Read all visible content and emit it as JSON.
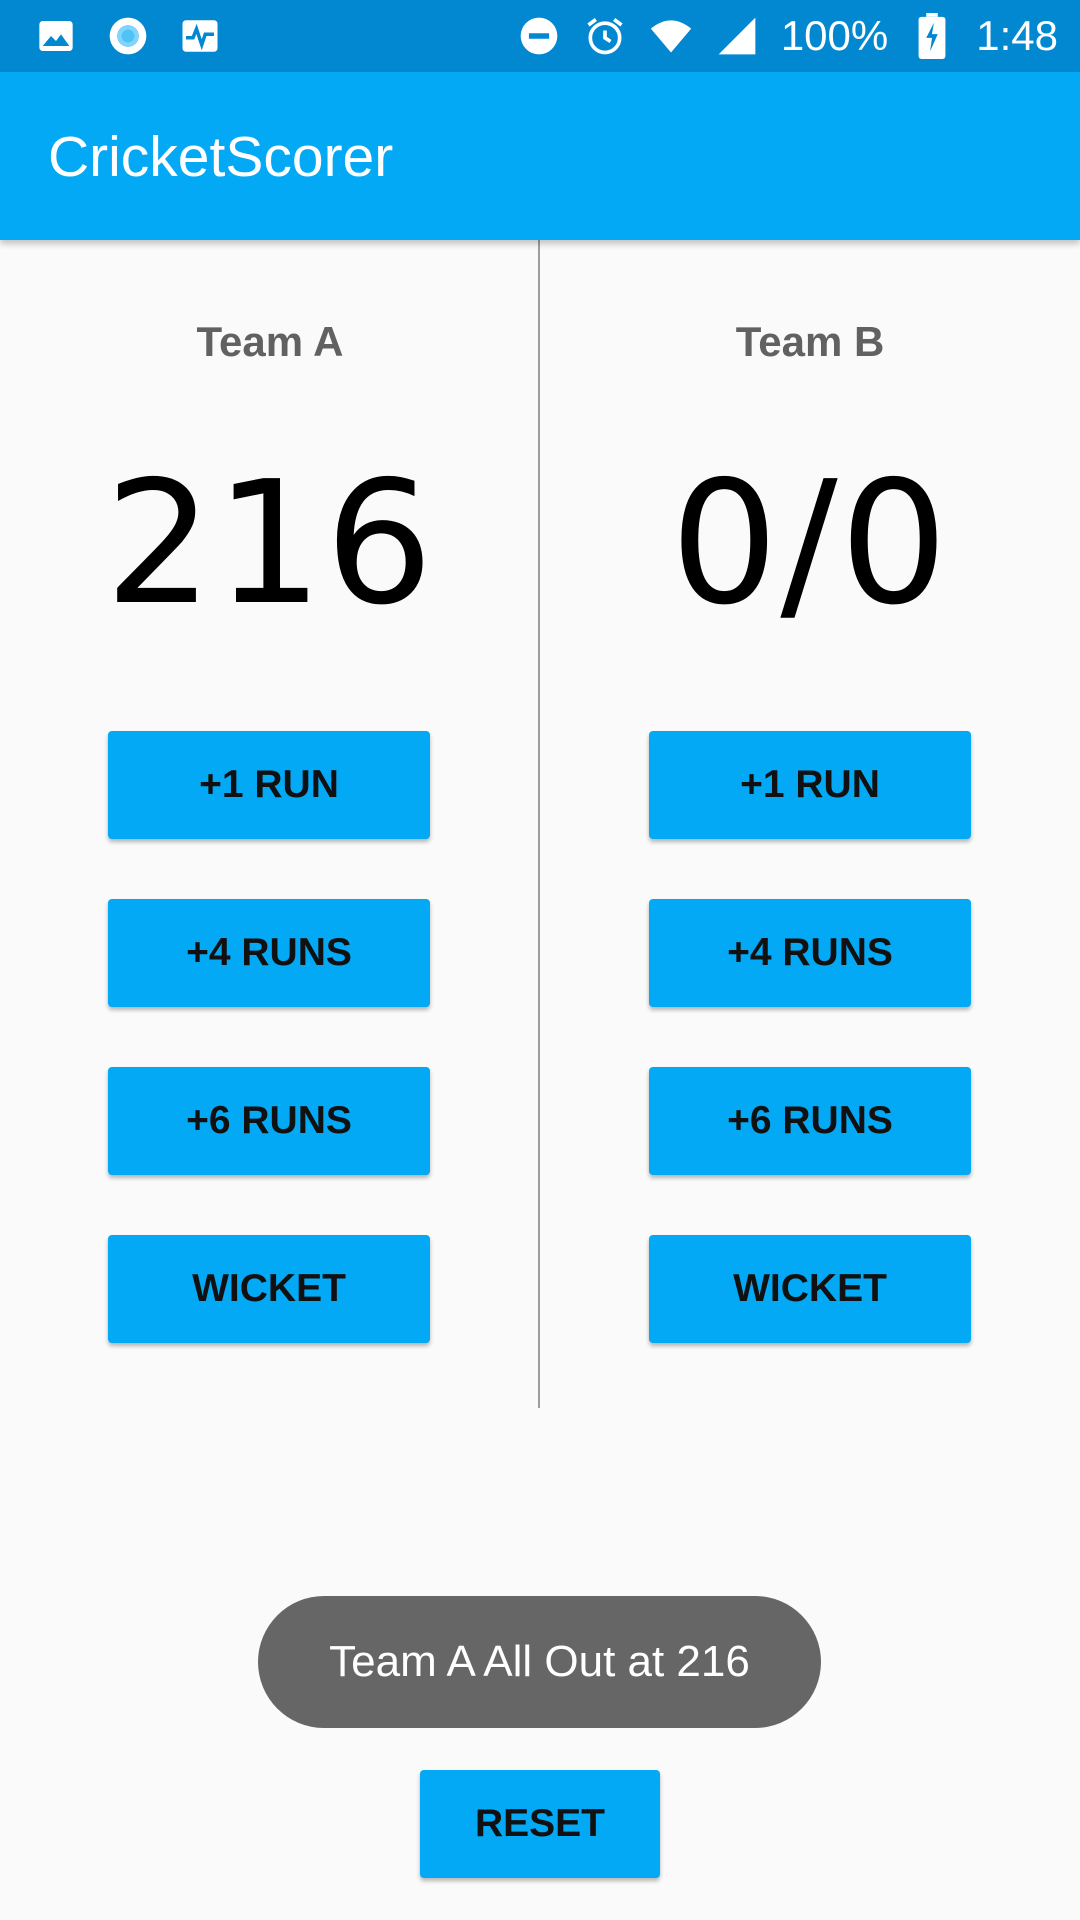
{
  "status_bar": {
    "left_icons": [
      "image-icon",
      "circle-record-icon",
      "activity-chart-icon"
    ],
    "right_icons": [
      "do-not-disturb-icon",
      "alarm-icon",
      "wifi-icon",
      "cell-signal-icon"
    ],
    "battery_percent": "100%",
    "battery_icon": "battery-charging-icon",
    "time": "1:48"
  },
  "app_bar": {
    "title": "CricketScorer"
  },
  "team_a": {
    "name": "Team A",
    "score": "216",
    "buttons": {
      "plus1": "+1 RUN",
      "plus4": "+4 RUNS",
      "plus6": "+6 RUNS",
      "wicket": "WICKET"
    }
  },
  "team_b": {
    "name": "Team B",
    "score": "0/0",
    "buttons": {
      "plus1": "+1 RUN",
      "plus4": "+4 RUNS",
      "plus6": "+6 RUNS",
      "wicket": "WICKET"
    }
  },
  "toast": {
    "message": "Team A All Out at 216"
  },
  "reset": {
    "label": "RESET"
  },
  "colors": {
    "status_bar": "#0288D1",
    "app_bar": "#03A9F4",
    "button": "#03A9F4",
    "background": "#FAFAFA",
    "toast": "#666666"
  }
}
